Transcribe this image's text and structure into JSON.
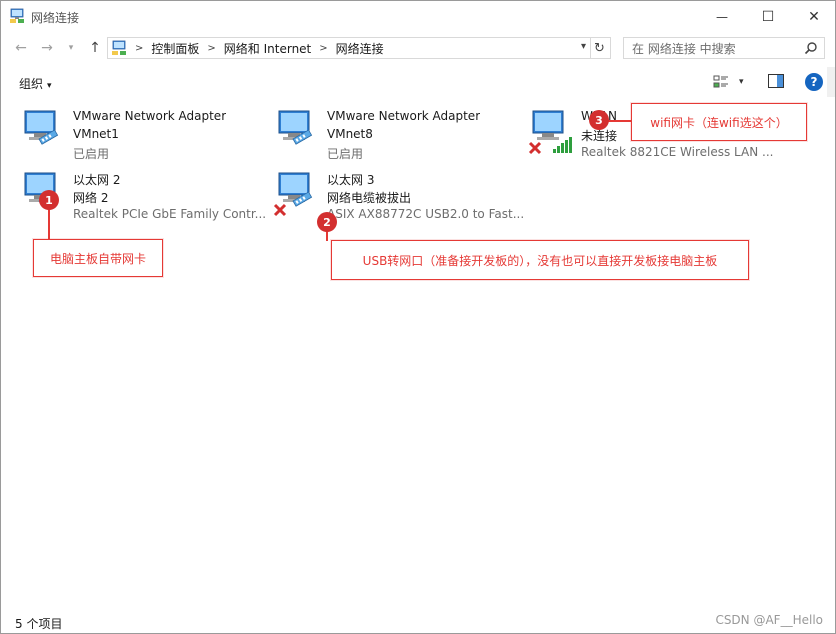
{
  "window": {
    "title": "网络连接",
    "controls": {
      "minimize": "—",
      "maximize": "☐",
      "close": "✕"
    }
  },
  "navigation": {
    "back": "←",
    "forward": "→",
    "history": "▾",
    "up": "↑",
    "breadcrumb": [
      "控制面板",
      "网络和 Internet",
      "网络连接"
    ],
    "refresh": "↻",
    "search_placeholder": "在 网络连接 中搜索"
  },
  "toolbar": {
    "organize_label": "组织",
    "organize_caret": "▾",
    "view_caret": "▾",
    "help_label": "?"
  },
  "connections": [
    {
      "name": "VMware Network Adapter",
      "subname": "VMnet1",
      "status": "已启用",
      "device": "",
      "state": "enabled"
    },
    {
      "name": "VMware Network Adapter",
      "subname": "VMnet8",
      "status": "已启用",
      "device": "",
      "state": "enabled"
    },
    {
      "name": "WLAN",
      "subname": "未连接",
      "status": "",
      "device": "Realtek 8821CE Wireless LAN ...",
      "state": "wifi-disconnected"
    },
    {
      "name": "以太网 2",
      "subname": "网络 2",
      "status": "",
      "device": "Realtek PCIe GbE Family Contr...",
      "state": "enabled"
    },
    {
      "name": "以太网 3",
      "subname": "网络电缆被拔出",
      "status": "",
      "device": "ASIX AX88772C USB2.0 to Fast...",
      "state": "unplugged"
    }
  ],
  "annotations": [
    {
      "number": "1",
      "text": "电脑主板自带网卡"
    },
    {
      "number": "2",
      "text": "USB转网口（准备接开发板的），没有也可以直接开发板接电脑主板"
    },
    {
      "number": "3",
      "text": "wifi网卡（连wifi选这个）"
    }
  ],
  "status_bar": {
    "item_count": "5 个项目",
    "watermark": "CSDN @AF__Hello"
  },
  "colors": {
    "annotation": "#e53935",
    "badge": "#d32f2f",
    "help": "#1565c0",
    "wifi_bars": "#2e9e3e",
    "error_x": "#d32f2f"
  }
}
